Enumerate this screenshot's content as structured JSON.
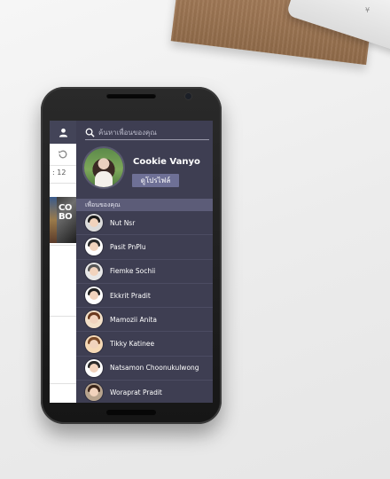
{
  "background": {
    "device_mark": "¥"
  },
  "sidebar": {
    "time_text": ": 12",
    "image_text": "CO\nBO"
  },
  "drawer": {
    "search_placeholder": "ค้นหาเพื่อนของคุณ",
    "profile": {
      "name": "Cookie Vanyo",
      "view_profile_button": "ดูโปรไฟล์"
    },
    "friends_header": "เพื่อนของคุณ",
    "friends": [
      {
        "name": "Nut Nsr",
        "hair": "#1a1a1a",
        "bg": "#dcdcdc"
      },
      {
        "name": "Pasit PnPlu",
        "hair": "#2b2b2b",
        "bg": "#ffffff"
      },
      {
        "name": "Fiemke Sochii",
        "hair": "#555555",
        "bg": "#e8e8e8"
      },
      {
        "name": "Ekkrit Pradit",
        "hair": "#222222",
        "bg": "#ffffff"
      },
      {
        "name": "Mamozii Anita",
        "hair": "#6b3a1f",
        "bg": "#f3e0c8"
      },
      {
        "name": "Tikky Katinee",
        "hair": "#7a4a28",
        "bg": "#f6d9b6"
      },
      {
        "name": "Natsamon Choonukulwong",
        "hair": "#2a2a2a",
        "bg": "#ffffff"
      },
      {
        "name": "Woraprat Pradit",
        "hair": "#3a2418",
        "bg": "#b8a48e"
      }
    ]
  },
  "colors": {
    "drawer_bg": "#3e3e52",
    "header_bg": "#5c5c78",
    "accent_button": "#6e7096"
  }
}
